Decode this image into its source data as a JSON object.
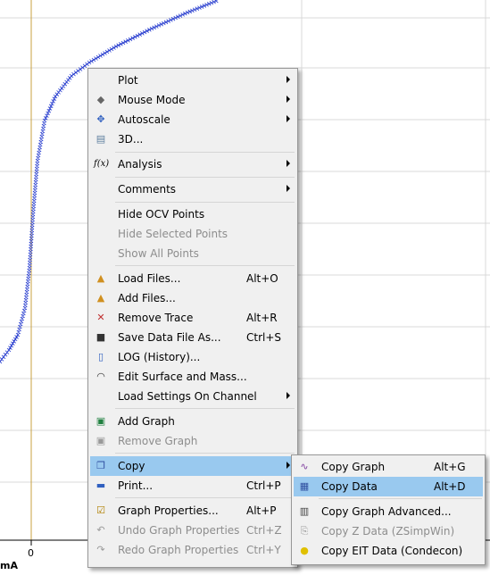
{
  "plot": {
    "x_zero_label": "0",
    "y_unit_label": "mA",
    "grid_color": "#d8d8d8",
    "zero_line_color": "#c8a040",
    "trace_color": "#2a3fcf"
  },
  "context_menu": {
    "items": [
      {
        "label": "Plot",
        "shortcut": "",
        "submenu": true,
        "disabled": false,
        "icon": ""
      },
      {
        "label": "Mouse Mode",
        "shortcut": "",
        "submenu": true,
        "disabled": false,
        "icon": "eraser-icon"
      },
      {
        "label": "Autoscale",
        "shortcut": "",
        "submenu": true,
        "disabled": false,
        "icon": "autoscale-icon"
      },
      {
        "label": "3D...",
        "shortcut": "",
        "submenu": false,
        "disabled": false,
        "icon": "3d-icon"
      },
      {
        "label": "Analysis",
        "shortcut": "",
        "submenu": true,
        "disabled": false,
        "icon": "function-icon"
      },
      {
        "label": "Comments",
        "shortcut": "",
        "submenu": true,
        "disabled": false,
        "icon": ""
      },
      {
        "label": "Hide OCV Points",
        "shortcut": "",
        "submenu": false,
        "disabled": false,
        "icon": ""
      },
      {
        "label": "Hide Selected Points",
        "shortcut": "",
        "submenu": false,
        "disabled": true,
        "icon": ""
      },
      {
        "label": "Show All Points",
        "shortcut": "",
        "submenu": false,
        "disabled": true,
        "icon": ""
      },
      {
        "label": "Load Files...",
        "shortcut": "Alt+O",
        "submenu": false,
        "disabled": false,
        "icon": "folder-open-icon"
      },
      {
        "label": "Add Files...",
        "shortcut": "",
        "submenu": false,
        "disabled": false,
        "icon": "folder-add-icon"
      },
      {
        "label": "Remove Trace",
        "shortcut": "Alt+R",
        "submenu": false,
        "disabled": false,
        "icon": "remove-trace-icon"
      },
      {
        "label": "Save Data File As...",
        "shortcut": "Ctrl+S",
        "submenu": false,
        "disabled": false,
        "icon": "floppy-icon"
      },
      {
        "label": "LOG (History)...",
        "shortcut": "",
        "submenu": false,
        "disabled": false,
        "icon": "log-icon"
      },
      {
        "label": "Edit Surface and Mass...",
        "shortcut": "",
        "submenu": false,
        "disabled": false,
        "icon": "beaker-icon"
      },
      {
        "label": "Load Settings On Channel",
        "shortcut": "",
        "submenu": true,
        "disabled": false,
        "icon": ""
      },
      {
        "label": "Add Graph",
        "shortcut": "",
        "submenu": false,
        "disabled": false,
        "icon": "add-graph-icon"
      },
      {
        "label": "Remove Graph",
        "shortcut": "",
        "submenu": false,
        "disabled": true,
        "icon": "remove-graph-icon"
      },
      {
        "label": "Copy",
        "shortcut": "",
        "submenu": true,
        "disabled": false,
        "icon": "copy-icon",
        "highlighted": true
      },
      {
        "label": "Print...",
        "shortcut": "Ctrl+P",
        "submenu": false,
        "disabled": false,
        "icon": "printer-icon"
      },
      {
        "label": "Graph Properties...",
        "shortcut": "Alt+P",
        "submenu": false,
        "disabled": false,
        "icon": "properties-icon"
      },
      {
        "label": "Undo Graph Properties",
        "shortcut": "Ctrl+Z",
        "submenu": false,
        "disabled": true,
        "icon": "undo-icon"
      },
      {
        "label": "Redo Graph Properties",
        "shortcut": "Ctrl+Y",
        "submenu": false,
        "disabled": true,
        "icon": "redo-icon"
      }
    ]
  },
  "copy_submenu": {
    "items": [
      {
        "label": "Copy Graph",
        "shortcut": "Alt+G",
        "disabled": false,
        "icon": "graph-icon"
      },
      {
        "label": "Copy Data",
        "shortcut": "Alt+D",
        "disabled": false,
        "icon": "table-icon",
        "highlighted": true
      },
      {
        "label": "Copy Graph Advanced...",
        "shortcut": "",
        "disabled": false,
        "icon": "graph-advanced-icon"
      },
      {
        "label": "Copy Z Data (ZSimpWin)",
        "shortcut": "",
        "disabled": true,
        "icon": "z-data-icon"
      },
      {
        "label": "Copy EIT Data (Condecon)",
        "shortcut": "",
        "disabled": false,
        "icon": "condecon-icon"
      }
    ]
  }
}
